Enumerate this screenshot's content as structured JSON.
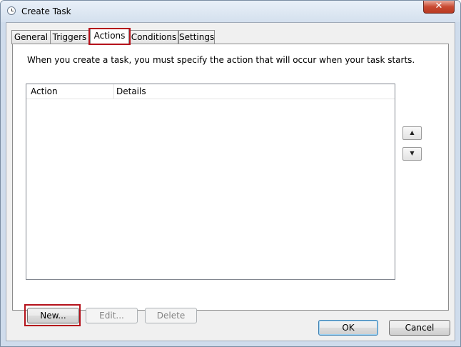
{
  "window": {
    "title": "Create Task",
    "close_glyph": "✕",
    "title_icon": "clock-icon"
  },
  "tabs": [
    {
      "label": "General",
      "active": false
    },
    {
      "label": "Triggers",
      "active": false
    },
    {
      "label": "Actions",
      "active": true
    },
    {
      "label": "Conditions",
      "active": false
    },
    {
      "label": "Settings",
      "active": false
    }
  ],
  "actions_tab": {
    "description": "When you create a task, you must specify the action that will occur when your task starts.",
    "list": {
      "columns": [
        "Action",
        "Details"
      ],
      "rows": []
    },
    "move_up_glyph": "▲",
    "move_down_glyph": "▼",
    "new_label": "New...",
    "edit_label": "Edit...",
    "delete_label": "Delete"
  },
  "footer": {
    "ok_label": "OK",
    "cancel_label": "Cancel"
  },
  "colors": {
    "highlight": "#b5121b",
    "titlebar": "#d4e0ee"
  }
}
